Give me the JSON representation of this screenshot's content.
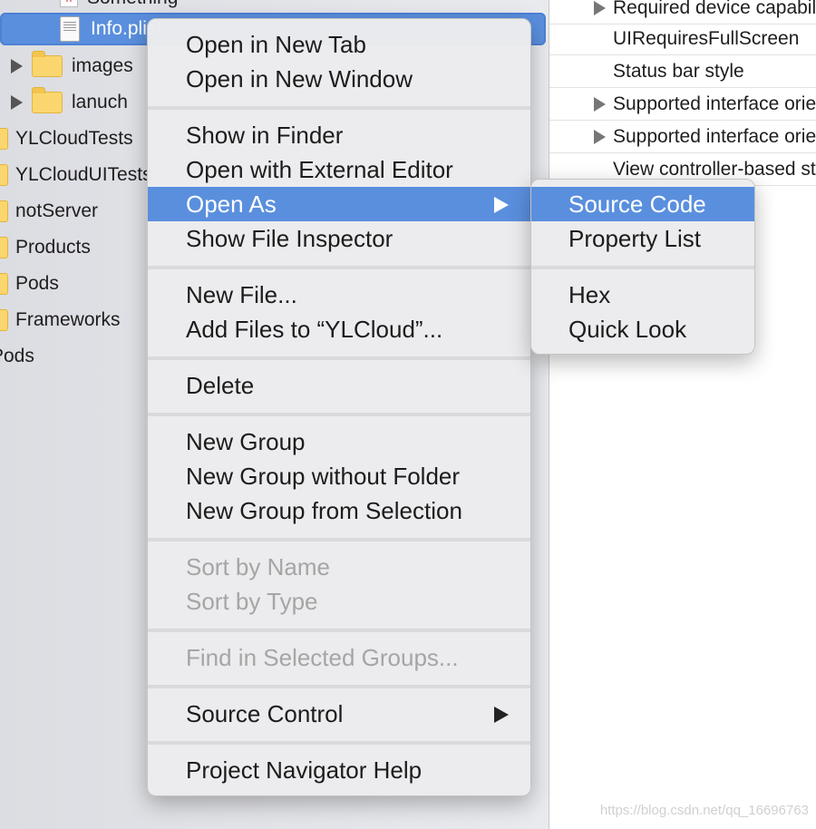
{
  "navigator": {
    "partial_top_label": "Something",
    "selected_item": "Info.plist",
    "items": [
      {
        "label": "images",
        "kind": "folder",
        "expandable": true
      },
      {
        "label": "lanuch",
        "kind": "folder",
        "expandable": true
      },
      {
        "label": "YLCloudTests",
        "kind": "folder"
      },
      {
        "label": "YLCloudUITests",
        "kind": "folder"
      },
      {
        "label": "notServer",
        "kind": "folder"
      },
      {
        "label": "Products",
        "kind": "folder"
      },
      {
        "label": "Pods",
        "kind": "folder"
      },
      {
        "label": "Frameworks",
        "kind": "folder"
      },
      {
        "label": "Pods",
        "kind": "group"
      }
    ]
  },
  "plist_editor": {
    "rows": [
      {
        "key": "Required device capabilities",
        "expandable": true
      },
      {
        "key": "UIRequiresFullScreen",
        "expandable": false
      },
      {
        "key": "Status bar style",
        "expandable": false
      },
      {
        "key": "Supported interface orientations",
        "expandable": true
      },
      {
        "key": "Supported interface orientations (iPad)",
        "expandable": true
      },
      {
        "key": "View controller-based status bar appearance",
        "expandable": false
      }
    ]
  },
  "context_menu": {
    "items": {
      "open_new_tab": "Open in New Tab",
      "open_new_window": "Open in New Window",
      "show_in_finder": "Show in Finder",
      "open_external_editor": "Open with External Editor",
      "open_as": "Open As",
      "show_file_inspector": "Show File Inspector",
      "new_file": "New File...",
      "add_files": "Add Files to “YLCloud”...",
      "delete": "Delete",
      "new_group": "New Group",
      "new_group_without_folder": "New Group without Folder",
      "new_group_from_selection": "New Group from Selection",
      "sort_by_name": "Sort by Name",
      "sort_by_type": "Sort by Type",
      "find_in_selected_groups": "Find in Selected Groups...",
      "source_control": "Source Control",
      "project_navigator_help": "Project Navigator Help"
    },
    "highlighted": "Open As",
    "disabled": [
      "Sort by Name",
      "Sort by Type",
      "Find in Selected Groups..."
    ]
  },
  "open_as_submenu": {
    "items": {
      "source_code": "Source Code",
      "property_list": "Property List",
      "hex": "Hex",
      "quick_look": "Quick Look"
    },
    "highlighted": "Source Code"
  },
  "watermark": "https://blog.csdn.net/qq_16696763",
  "colors": {
    "selection": "#5a8fde",
    "menu_background": "#ececee",
    "disabled_text": "#a5a5a5",
    "folder": "#fbd66e"
  }
}
